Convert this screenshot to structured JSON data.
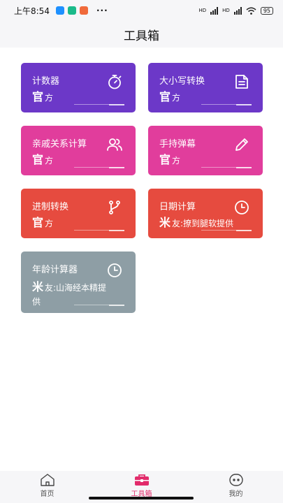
{
  "status_bar": {
    "time": "上午8:54",
    "dots": "···",
    "signal_label_1": "HD",
    "signal_label_2": "HD",
    "battery": "95",
    "app_icons": [
      "#1e90ff",
      "#1aba8a",
      "#f06a3b"
    ]
  },
  "header": {
    "title": "工具箱"
  },
  "tools": [
    {
      "title": "计数器",
      "tag_big": "官",
      "tag_text": "方",
      "icon": "stopwatch-icon",
      "color": "purple"
    },
    {
      "title": "大小写转换",
      "tag_big": "官",
      "tag_text": "方",
      "icon": "document-icon",
      "color": "purple"
    },
    {
      "title": "亲戚关系计算",
      "tag_big": "官",
      "tag_text": "方",
      "icon": "users-icon",
      "color": "pink"
    },
    {
      "title": "手持弹幕",
      "tag_big": "官",
      "tag_text": "方",
      "icon": "pencil-icon",
      "color": "pink"
    },
    {
      "title": "进制转换",
      "tag_big": "官",
      "tag_text": "方",
      "icon": "branch-icon",
      "color": "red"
    },
    {
      "title": "日期计算",
      "tag_big": "米",
      "tag_text": "友:撩到腿软提供",
      "icon": "clock-icon",
      "color": "red"
    },
    {
      "title": "年龄计算器",
      "tag_big": "米",
      "tag_text": "友:山海经本精提供",
      "icon": "clock-icon",
      "color": "gray"
    }
  ],
  "colors": {
    "purple": "#6c38c8",
    "pink": "#e13d9c",
    "red": "#e64b3f",
    "gray": "#8e9ea5",
    "accent": "#e22b6b"
  },
  "tabbar": {
    "items": [
      {
        "label": "首页",
        "icon": "home-icon",
        "active": false
      },
      {
        "label": "工具箱",
        "icon": "toolbox-icon",
        "active": true
      },
      {
        "label": "我的",
        "icon": "face-icon",
        "active": false
      }
    ]
  }
}
